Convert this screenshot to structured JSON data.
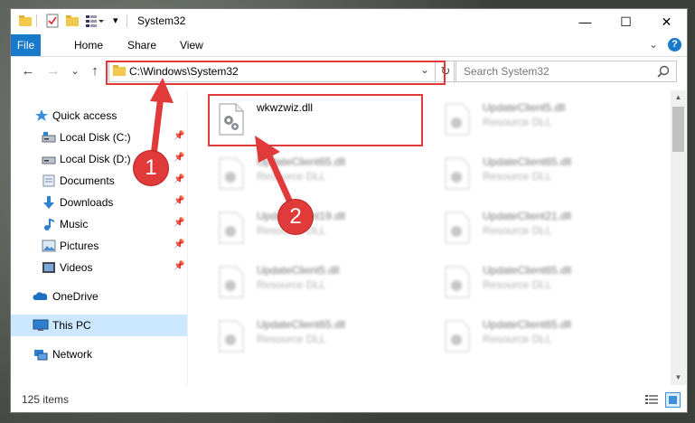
{
  "window": {
    "title": "System32",
    "minimize_glyph": "—",
    "maximize_glyph": "☐",
    "close_glyph": "✕"
  },
  "ribbon": {
    "tabs": [
      {
        "label": "File"
      },
      {
        "label": "Home"
      },
      {
        "label": "Share"
      },
      {
        "label": "View"
      }
    ],
    "help_glyph": "?",
    "expand_glyph": "⌄"
  },
  "address": {
    "path": "C:\\Windows\\System32",
    "dropdown_glyph": "⌄",
    "refresh_glyph": "↻"
  },
  "search": {
    "placeholder": "Search System32",
    "icon": "search-icon"
  },
  "nav_buttons": {
    "back": "←",
    "forward": "→",
    "recent": "⌄",
    "up": "↑"
  },
  "sidebar": {
    "items": [
      {
        "label": "Quick access",
        "icon": "star-icon",
        "pinned": false
      },
      {
        "label": "Local Disk (C:)",
        "icon": "drive-icon",
        "pinned": true
      },
      {
        "label": "Local Disk (D:)",
        "icon": "drive-icon",
        "pinned": true
      },
      {
        "label": "Documents",
        "icon": "documents-icon",
        "pinned": true
      },
      {
        "label": "Downloads",
        "icon": "downloads-icon",
        "pinned": true
      },
      {
        "label": "Music",
        "icon": "music-icon",
        "pinned": true
      },
      {
        "label": "Pictures",
        "icon": "pictures-icon",
        "pinned": true
      },
      {
        "label": "Videos",
        "icon": "videos-icon",
        "pinned": true
      },
      {
        "label": "OneDrive",
        "icon": "onedrive-icon",
        "pinned": false
      },
      {
        "label": "This PC",
        "icon": "computer-icon",
        "pinned": false,
        "selected": true
      },
      {
        "label": "Network",
        "icon": "network-icon",
        "pinned": false
      }
    ],
    "pin_glyph": "📌"
  },
  "files": [
    {
      "name": "wkwzwiz.dll",
      "type": "",
      "highlighted": true
    },
    {
      "name": "UpdateClient5.dll",
      "type": "Resource DLL"
    },
    {
      "name": "UpdateClient65.dll",
      "type": "Resource DLL"
    },
    {
      "name": "UpdateClient65.dll",
      "type": "Resource DLL"
    },
    {
      "name": "UpdateClient19.dll",
      "type": "Resource DLL"
    },
    {
      "name": "UpdateClient21.dll",
      "type": "Resource DLL"
    },
    {
      "name": "UpdateClient5.dll",
      "type": "Resource DLL"
    },
    {
      "name": "UpdateClient65.dll",
      "type": "Resource DLL"
    },
    {
      "name": "UpdateClient65.dll",
      "type": "Resource DLL"
    },
    {
      "name": "UpdateClient65.dll",
      "type": "Resource DLL"
    }
  ],
  "status": {
    "count": "125 items"
  },
  "annotations": {
    "step1": "1",
    "step2": "2",
    "color": "#e03a3a"
  },
  "colors": {
    "file_tab": "#1979ca",
    "selection": "#cce8ff"
  }
}
